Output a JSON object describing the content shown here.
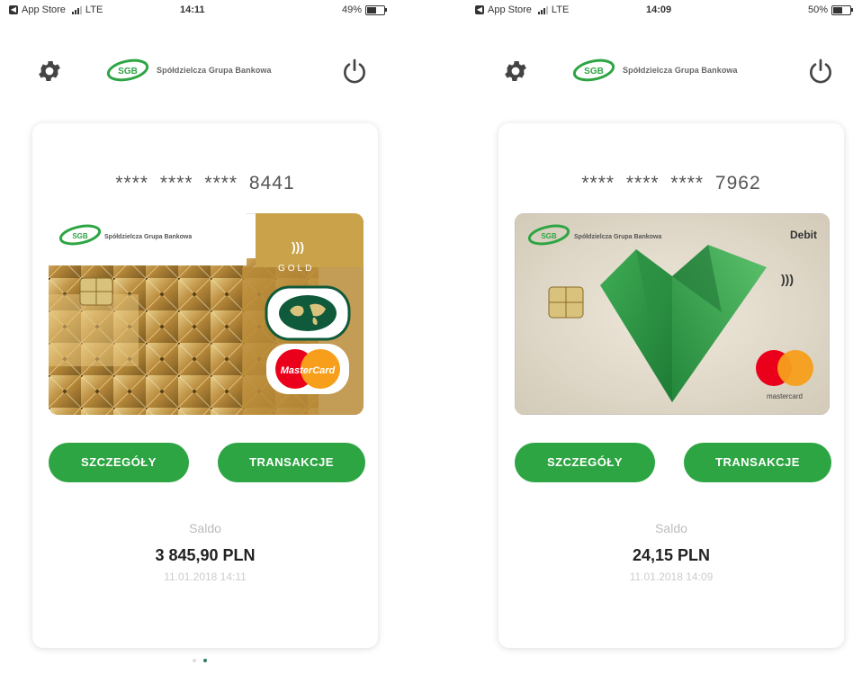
{
  "screens": [
    {
      "status": {
        "carrier": "App Store",
        "network": "LTE",
        "time": "14:11",
        "battery": "49%",
        "battery_level": 0.49
      },
      "bank_name": "Spółdzielcza Grupa Bankowa",
      "logo_text": "SGB",
      "card": {
        "masked_number": "**** **** **** 8441",
        "type": "gold",
        "card_bank_name": "Spółdzielcza Grupa Bankowa",
        "tier_text": "GOLD",
        "brand_text": "MasterCard"
      },
      "buttons": {
        "details": "SZCZEGÓŁY",
        "transactions": "TRANSAKCJE"
      },
      "balance": {
        "label": "Saldo",
        "amount": "3 845,90 PLN",
        "datetime": "11.01.2018 14:11"
      }
    },
    {
      "status": {
        "carrier": "App Store",
        "network": "LTE",
        "time": "14:09",
        "battery": "50%",
        "battery_level": 0.5
      },
      "bank_name": "Spółdzielcza Grupa Bankowa",
      "logo_text": "SGB",
      "card": {
        "masked_number": "**** **** **** 7962",
        "type": "debit",
        "card_bank_name": "Spółdzielcza Grupa Bankowa",
        "tier_text": "Debit",
        "brand_text": "mastercard"
      },
      "buttons": {
        "details": "SZCZEGÓŁY",
        "transactions": "TRANSAKCJE"
      },
      "balance": {
        "label": "Saldo",
        "amount": "24,15 PLN",
        "datetime": "11.01.2018 14:09"
      }
    }
  ],
  "pager": {
    "count": 2,
    "active_index": 1
  },
  "colors": {
    "accent": "#2ea543",
    "gold": "#c9a24a",
    "debit_green": "#2a9a43"
  },
  "icons": [
    "settings-gear-icon",
    "power-icon",
    "sgb-logo",
    "contactless-icon",
    "chip-icon",
    "mastercard-logo",
    "world-map-icon"
  ]
}
